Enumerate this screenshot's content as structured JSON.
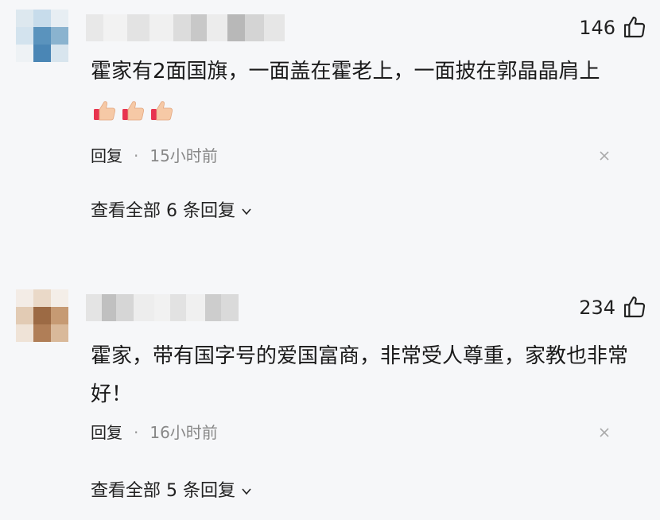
{
  "comments": [
    {
      "likes": "146",
      "text": "霍家有2面国旗，一面盖在霍老上，一面披在郭晶晶肩上",
      "emojis": [
        "thumbs-up-icon",
        "thumbs-up-icon",
        "thumbs-up-icon"
      ],
      "reply_label": "回复",
      "separator": "·",
      "time": "15小时前",
      "view_replies": "查看全部 6 条回复"
    },
    {
      "likes": "234",
      "text": "霍家，带有国字号的爱国富商，非常受人尊重，家教也非常好！",
      "reply_label": "回复",
      "separator": "·",
      "time": "16小时前",
      "view_replies": "查看全部 5 条回复"
    }
  ],
  "icons": {
    "like": "like-thumb-icon",
    "close": "close-icon",
    "expand": "chevron-down-icon"
  },
  "colors": {
    "background": "#f6f7f9",
    "text": "#1a1a1a",
    "muted": "#888888"
  }
}
